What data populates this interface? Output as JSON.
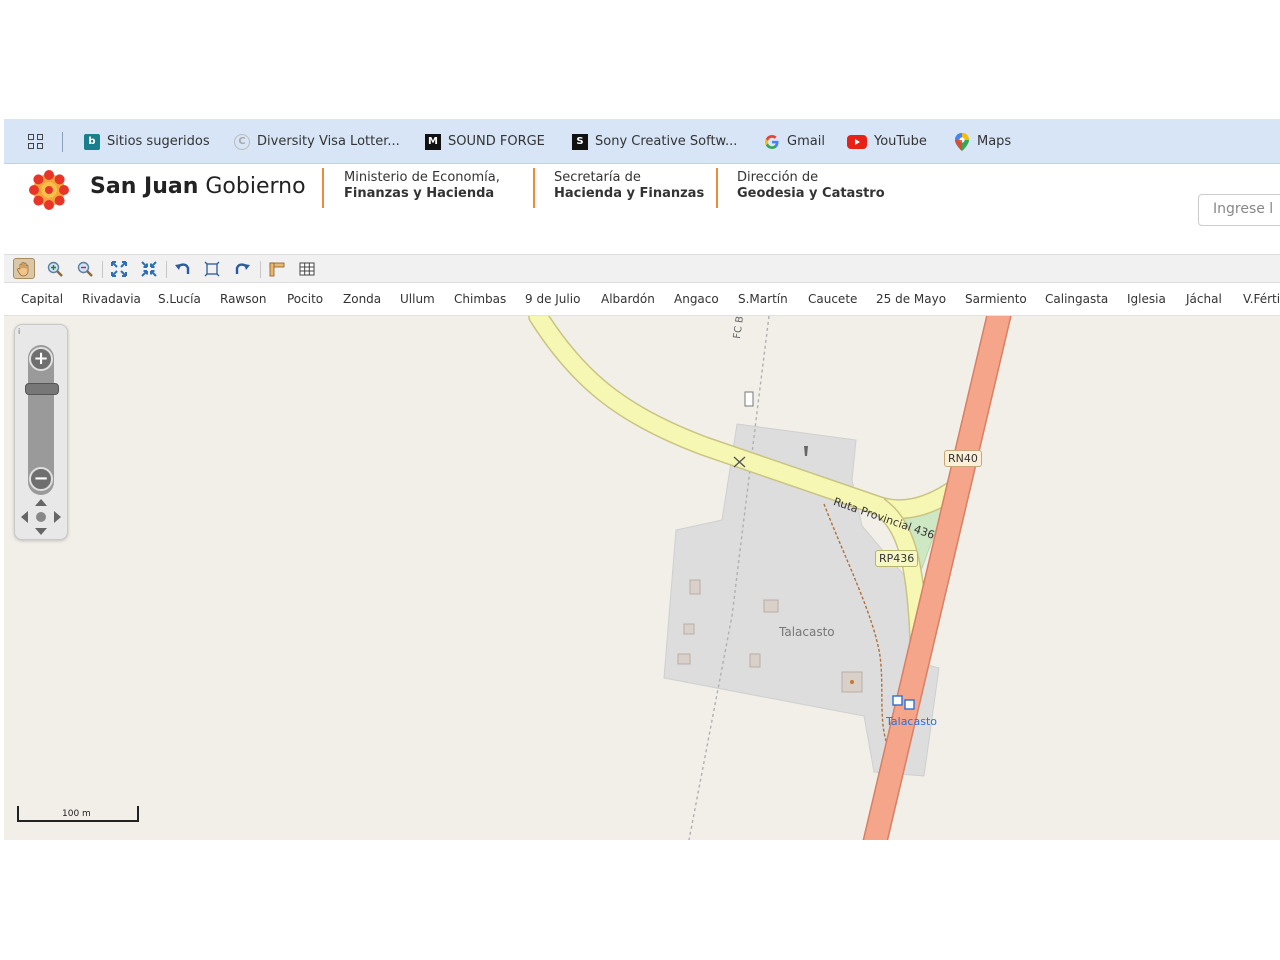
{
  "bookmarks": {
    "items": [
      {
        "label": "Sitios sugeridos",
        "icon": "bing-icon"
      },
      {
        "label": "Diversity Visa Lotter...",
        "icon": "page-icon"
      },
      {
        "label": "SOUND FORGE",
        "icon": "m-logo-icon"
      },
      {
        "label": "Sony Creative Softw...",
        "icon": "s-logo-icon"
      },
      {
        "label": "Gmail",
        "icon": "google-icon"
      },
      {
        "label": "YouTube",
        "icon": "youtube-icon"
      },
      {
        "label": "Maps",
        "icon": "maps-pin-icon"
      }
    ]
  },
  "header": {
    "brand_bold": "San Juan",
    "brand_light": "Gobierno",
    "blocks": [
      {
        "line1": "Ministerio de Economía,",
        "line2": "Finanzas y Hacienda"
      },
      {
        "line1": "Secretaría de",
        "line2": "Hacienda y Finanzas"
      },
      {
        "line1": "Dirección de",
        "line2": "Geodesia y Catastro"
      }
    ],
    "search_placeholder": "Ingrese l",
    "accent_color": "#f08a3c"
  },
  "toolbar": {
    "tools": [
      "pan-hand-icon",
      "zoom-in-icon",
      "zoom-out-icon",
      "zoom-extent-icon",
      "zoom-fit-icon",
      "undo-icon",
      "select-box-icon",
      "redo-icon",
      "measure-icon",
      "grid-icon"
    ],
    "active_tool": "pan-hand-icon"
  },
  "departments": [
    "Capital",
    "Rivadavia",
    "S.Lucía",
    "Rawson",
    "Pocito",
    "Zonda",
    "Ullum",
    "Chimbas",
    "9 de Julio",
    "Albardón",
    "Angaco",
    "S.Martín",
    "Caucete",
    "25 de Mayo",
    "Sarmiento",
    "Calingasta",
    "Iglesia",
    "Jáchal",
    "V.Férti"
  ],
  "map": {
    "labels": {
      "railway": "FC Belgrano",
      "route_name": "Ruta Provincial 436",
      "rn_shield": "RN40",
      "rp_shield": "RP436",
      "town": "Talacasto",
      "bus_stop": "Talacasto"
    },
    "scale_label": "100 m",
    "colors": {
      "background": "#f2efe9",
      "national_road": "#f4a58a",
      "provincial_road": "#f7f7b4",
      "residential": "#dddddd",
      "park": "#cfe8c4"
    }
  }
}
